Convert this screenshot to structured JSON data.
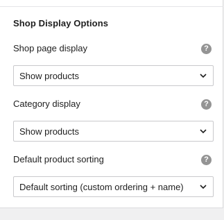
{
  "section": {
    "title": "Shop Display Options"
  },
  "fields": [
    {
      "label": "Shop page display",
      "help": "?",
      "value": "Show products"
    },
    {
      "label": "Category display",
      "help": "?",
      "value": "Show products"
    },
    {
      "label": "Default product sorting",
      "help": "?",
      "value": "Default sorting (custom ordering + name)"
    }
  ],
  "icons": {
    "help": "question-circle-icon",
    "dropdown": "chevron-down-icon"
  },
  "colors": {
    "text": "#1e1e1e",
    "help_icon": "#949494",
    "border": "#c9c9cc",
    "background": "#f0f0f1"
  }
}
